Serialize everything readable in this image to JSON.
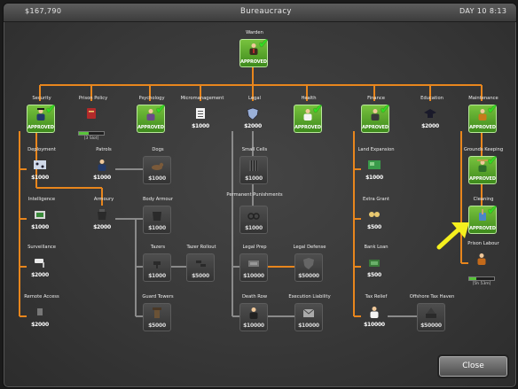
{
  "header": {
    "money": "$167,790",
    "title": "Bureaucracy",
    "clock": "DAY 10 8:13"
  },
  "colors": {
    "approved": "#4caf2a",
    "available": "#5a72a0",
    "locked": "#444444",
    "connector": "#e8861d",
    "pointer": "#f5f01e"
  },
  "nodes": [
    {
      "id": "warden",
      "label": "Warden",
      "state": "approved",
      "value": "APPROVED",
      "icon": "warden-icon"
    },
    {
      "id": "security",
      "label": "Security",
      "state": "approved",
      "value": "APPROVED",
      "icon": "security-icon"
    },
    {
      "id": "prison-policy",
      "label": "Prison Policy",
      "state": "available",
      "value": "",
      "icon": "policy-book-icon",
      "progress": 0.4,
      "sub": "[3 Slot]"
    },
    {
      "id": "psychology",
      "label": "Psychology",
      "state": "approved",
      "value": "APPROVED",
      "icon": "psychologist-icon"
    },
    {
      "id": "micromanagement",
      "label": "Micromanagement",
      "state": "available",
      "value": "$1000",
      "icon": "clipboard-icon"
    },
    {
      "id": "legal",
      "label": "Legal",
      "state": "available",
      "value": "$2000",
      "icon": "legal-shield-icon"
    },
    {
      "id": "health",
      "label": "Health",
      "state": "approved",
      "value": "APPROVED",
      "icon": "doctor-icon"
    },
    {
      "id": "finance",
      "label": "Finance",
      "state": "approved",
      "value": "APPROVED",
      "icon": "accountant-icon"
    },
    {
      "id": "education",
      "label": "Education",
      "state": "available",
      "value": "$2000",
      "icon": "graduation-cap-icon"
    },
    {
      "id": "maintenance",
      "label": "Maintenance",
      "state": "approved",
      "value": "APPROVED",
      "icon": "maintenance-icon"
    },
    {
      "id": "deployment",
      "label": "Deployment",
      "state": "available",
      "value": "$1000",
      "icon": "deployment-icon"
    },
    {
      "id": "patrols",
      "label": "Patrols",
      "state": "available",
      "value": "$1000",
      "icon": "patrol-icon"
    },
    {
      "id": "dogs",
      "label": "Dogs",
      "state": "locked",
      "value": "$1000",
      "icon": "dog-icon"
    },
    {
      "id": "intelligence",
      "label": "Intelligence",
      "state": "available",
      "value": "$1000",
      "icon": "intelligence-icon"
    },
    {
      "id": "armoury",
      "label": "Armoury",
      "state": "available",
      "value": "$2000",
      "icon": "armoury-icon"
    },
    {
      "id": "body-armour",
      "label": "Body Armour",
      "state": "locked",
      "value": "$1000",
      "icon": "body-armour-icon"
    },
    {
      "id": "surveillance",
      "label": "Surveillance",
      "state": "available",
      "value": "$2000",
      "icon": "cctv-camera-icon"
    },
    {
      "id": "tazers",
      "label": "Tazers",
      "state": "locked",
      "value": "$1000",
      "icon": "tazer-icon"
    },
    {
      "id": "tazer-rollout",
      "label": "Tazer Rollout",
      "state": "locked",
      "value": "$5000",
      "icon": "tazer-rollout-icon"
    },
    {
      "id": "remote-access",
      "label": "Remote Access",
      "state": "available",
      "value": "$2000",
      "icon": "remote-door-icon"
    },
    {
      "id": "guard-towers",
      "label": "Guard Towers",
      "state": "locked",
      "value": "$5000",
      "icon": "guard-tower-icon"
    },
    {
      "id": "small-cells",
      "label": "Small Cells",
      "state": "locked",
      "value": "$1000",
      "icon": "cell-bars-icon"
    },
    {
      "id": "permanent-punishments",
      "label": "Permanent Punishments",
      "state": "locked",
      "value": "$1000",
      "icon": "shackles-icon"
    },
    {
      "id": "legal-prep",
      "label": "Legal Prep",
      "state": "locked",
      "value": "$10000",
      "icon": "legal-prep-icon"
    },
    {
      "id": "legal-defense",
      "label": "Legal Defense",
      "state": "locked",
      "value": "$50000",
      "icon": "legal-defense-icon"
    },
    {
      "id": "death-row",
      "label": "Death Row",
      "state": "locked",
      "value": "$10000",
      "icon": "death-row-icon"
    },
    {
      "id": "execution-liability",
      "label": "Execution Liability",
      "state": "locked",
      "value": "$10000",
      "icon": "envelope-icon"
    },
    {
      "id": "land-expansion",
      "label": "Land Expansion",
      "state": "available",
      "value": "$1000",
      "icon": "map-icon"
    },
    {
      "id": "extra-grant",
      "label": "Extra Grant",
      "state": "available",
      "value": "$500",
      "icon": "grant-money-icon"
    },
    {
      "id": "bank-loan",
      "label": "Bank Loan",
      "state": "available",
      "value": "$500",
      "icon": "bank-loan-icon"
    },
    {
      "id": "tax-relief",
      "label": "Tax Relief",
      "state": "available",
      "value": "$10000",
      "icon": "tax-relief-icon"
    },
    {
      "id": "offshore-tax-haven",
      "label": "Offshore Tax Haven",
      "state": "locked",
      "value": "$50000",
      "icon": "offshore-icon"
    },
    {
      "id": "grounds-keeping",
      "label": "Grounds Keeping",
      "state": "approved",
      "value": "APPROVED",
      "icon": "gardener-icon"
    },
    {
      "id": "cleaning",
      "label": "Cleaning",
      "state": "approved",
      "value": "APPROVED",
      "icon": "cleaning-bucket-icon"
    },
    {
      "id": "prison-labour",
      "label": "Prison Labour",
      "state": "available",
      "value": "",
      "icon": "prison-labour-icon",
      "progress": 0.3,
      "sub": "[5h 53m]"
    }
  ],
  "close_label": "Close"
}
